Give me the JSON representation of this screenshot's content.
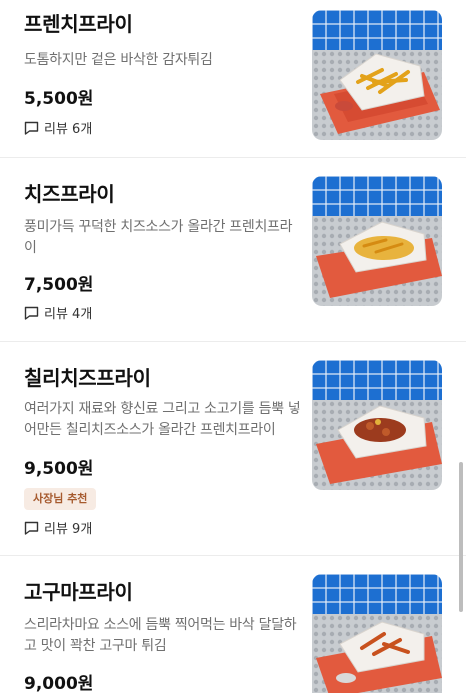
{
  "menu": {
    "items": [
      {
        "name": "프렌치프라이",
        "description": "도톰하지만 겉은 바삭한 감자튀김",
        "price": "5,500원",
        "reviews": "리뷰 6개",
        "image_icon": "french-fries-photo"
      },
      {
        "name": "치즈프라이",
        "description": "풍미가득 꾸덕한 치즈소스가 올라간 프렌치프라이",
        "price": "7,500원",
        "reviews": "리뷰 4개",
        "image_icon": "cheese-fries-photo"
      },
      {
        "name": "칠리치즈프라이",
        "description": "여러가지 재료와 향신료 그리고 소고기를 듬뿍 넣어만든 칠리치즈소스가 올라간 프렌치프라이",
        "price": "9,500원",
        "badge": "사장님 추천",
        "reviews": "리뷰 9개",
        "image_icon": "chili-cheese-fries-photo"
      },
      {
        "name": "고구마프라이",
        "description": "스리라차마요 소스에 듬뿍 찍어먹는 바삭 달달하고 맛이 꽉찬 고구마 튀김",
        "price": "9,000원",
        "image_icon": "sweet-potato-fries-photo"
      }
    ]
  },
  "colors": {
    "badge_bg": "#f7ebe3",
    "badge_text": "#a65a2e",
    "tile_blue": "#1565c9",
    "tray_red": "#e0513a"
  }
}
